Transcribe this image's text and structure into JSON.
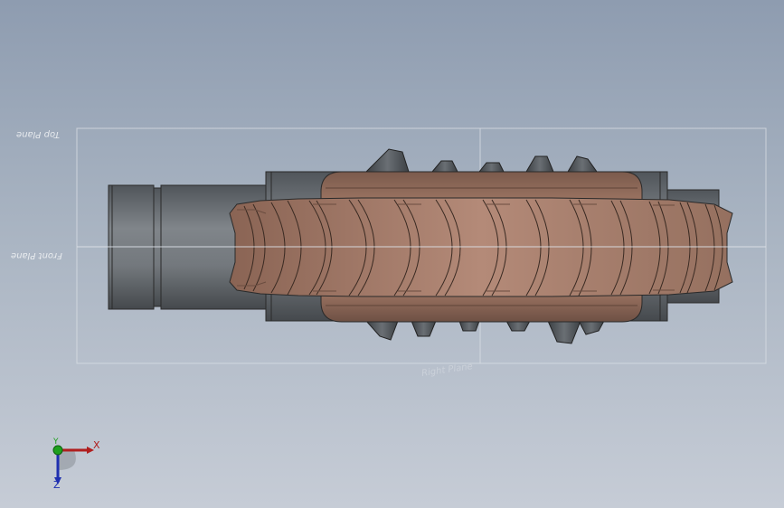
{
  "viewport": {
    "background_top": "#8e9cb0",
    "background_bottom": "#c6ccd6"
  },
  "planes": {
    "top_plane_label": "Top Plane",
    "front_plane_label": "Front Plane",
    "right_plane_label": "Right Plane"
  },
  "model": {
    "shaft_color": "#6b7075",
    "gear_color": "#a87c68",
    "edge_color": "#2a2a2a"
  },
  "triad": {
    "x_label": "X",
    "y_label": "Y",
    "z_label": "Z",
    "x_color": "#b01e1e",
    "y_color": "#1ea01e",
    "z_color": "#1e2fb0"
  }
}
